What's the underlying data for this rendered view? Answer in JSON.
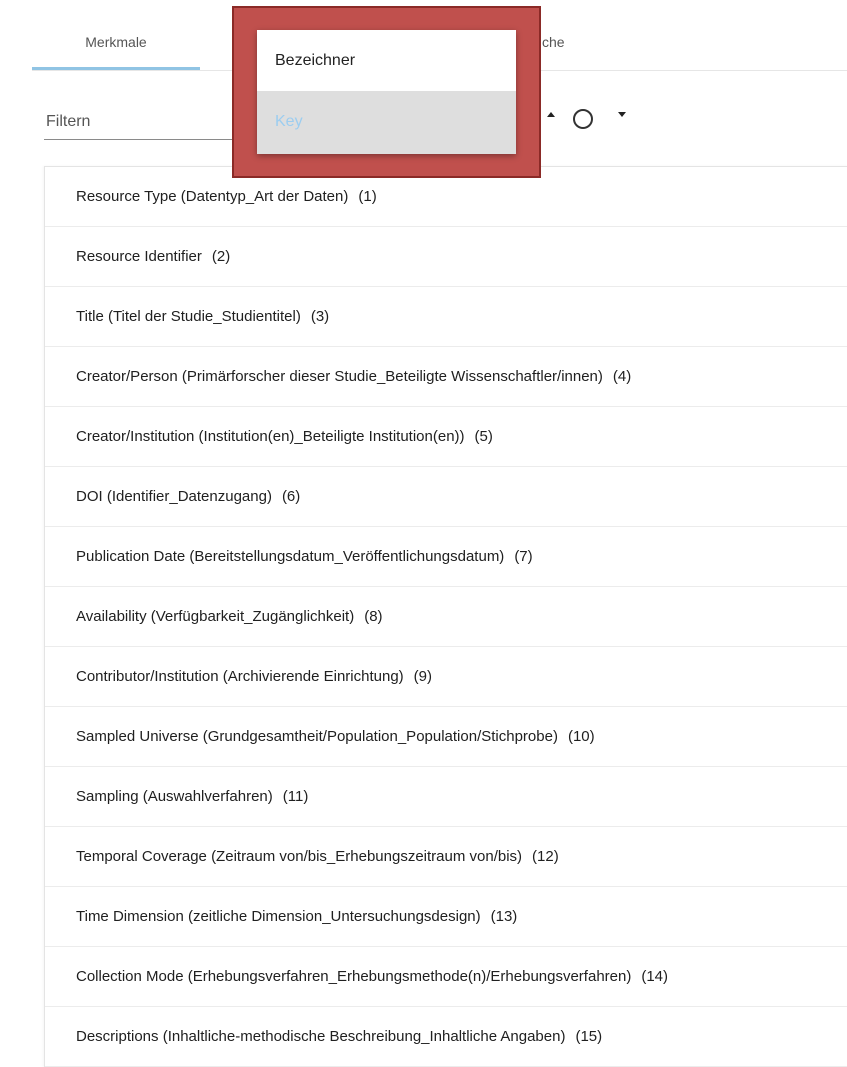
{
  "tabs": {
    "merkmale": "Merkmale",
    "partial_hidden": "che"
  },
  "filter": {
    "placeholder": "Filtern"
  },
  "dropdown": {
    "options": [
      "Bezeichner",
      "Key"
    ],
    "highlighted_index": 1,
    "frame_color": "#c0504d",
    "highlight_text_color": "#9ccdf0"
  },
  "colors": {
    "tab_indicator": "#90c4e4"
  },
  "icons": {
    "sort_up": "triangle-up-icon",
    "sort_radio": "circle-radio-icon",
    "sort_down": "triangle-down-icon"
  },
  "items": [
    {
      "label": "Resource Type (Datentyp_Art der Daten)",
      "count": "(1)"
    },
    {
      "label": "Resource Identifier",
      "count": "(2)"
    },
    {
      "label": "Title (Titel der Studie_Studientitel)",
      "count": "(3)"
    },
    {
      "label": "Creator/Person (Primärforscher dieser Studie_Beteiligte Wissenschaftler/innen)",
      "count": "(4)"
    },
    {
      "label": "Creator/Institution (Institution(en)_Beteiligte Institution(en))",
      "count": "(5)"
    },
    {
      "label": "DOI (Identifier_Datenzugang)",
      "count": "(6)"
    },
    {
      "label": "Publication Date (Bereitstellungsdatum_Veröffentlichungsdatum)",
      "count": "(7)"
    },
    {
      "label": "Availability (Verfügbarkeit_Zugänglichkeit)",
      "count": "(8)"
    },
    {
      "label": "Contributor/Institution (Archivierende Einrichtung)",
      "count": "(9)"
    },
    {
      "label": "Sampled Universe (Grundgesamtheit/Population_Population/Stichprobe)",
      "count": "(10)"
    },
    {
      "label": "Sampling (Auswahlverfahren)",
      "count": "(11)"
    },
    {
      "label": "Temporal Coverage (Zeitraum von/bis_Erhebungszeitraum von/bis)",
      "count": "(12)"
    },
    {
      "label": "Time Dimension (zeitliche Dimension_Untersuchungsdesign)",
      "count": "(13)"
    },
    {
      "label": "Collection Mode (Erhebungsverfahren_Erhebungsmethode(n)/Erhebungsverfahren)",
      "count": "(14)"
    },
    {
      "label": "Descriptions (Inhaltliche-methodische Beschreibung_Inhaltliche Angaben)",
      "count": "(15)"
    }
  ]
}
